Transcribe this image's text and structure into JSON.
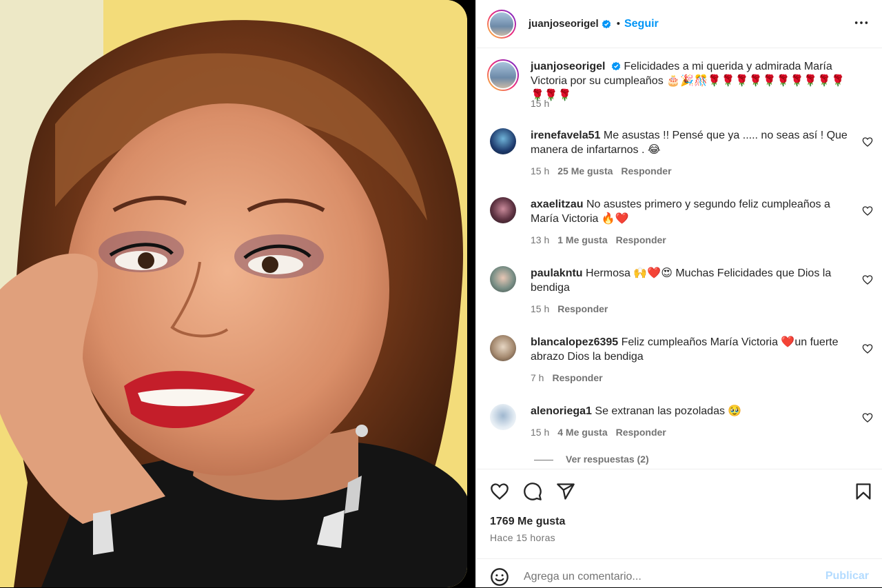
{
  "post": {
    "author": "juanjoseorigel",
    "follow_label": "Seguir",
    "separator": "•",
    "caption": "Felicidades a mi querida y admirada María Victoria por su cumpleaños 🎂🎉🎊🌹🌹🌹🌹🌹🌹🌹🌹🌹🌹🌹🌹🌹",
    "caption_time": "15 h"
  },
  "comments": [
    {
      "user": "irenefavela51",
      "text": "Me asustas !! Pensé que ya ..... no seas así ! Que manera de infartarnos . 😂",
      "time": "15 h",
      "likes": "25 Me gusta",
      "reply": "Responder"
    },
    {
      "user": "axaelitzau",
      "text": "No asustes primero y segundo feliz cumpleaños a María Victoria 🔥❤️",
      "time": "13 h",
      "likes": "1 Me gusta",
      "reply": "Responder"
    },
    {
      "user": "paulakntu",
      "text": "Hermosa 🙌❤️😍 Muchas Felicidades que Dios la bendiga",
      "time": "15 h",
      "likes": "",
      "reply": "Responder"
    },
    {
      "user": "blancalopez6395",
      "text": "Feliz cumpleaños María Victoria ❤️un fuerte abrazo Dios la bendiga",
      "time": "7 h",
      "likes": "",
      "reply": "Responder"
    },
    {
      "user": "alenoriega1",
      "text": "Se extranan las pozoladas 🥹",
      "time": "15 h",
      "likes": "4 Me gusta",
      "reply": "Responder"
    }
  ],
  "view_replies": "Ver respuestas (2)",
  "likes_total": "1769 Me gusta",
  "posted_ago": "Hace 15 horas",
  "add_comment": {
    "placeholder": "Agrega un comentario...",
    "publish_label": "Publicar"
  },
  "colors": {
    "accent": "#0095f6",
    "publish_disabled": "#b3dbff",
    "muted": "#737373"
  },
  "icons": [
    "verified-badge-icon",
    "more-options-icon",
    "heart-icon",
    "comment-icon",
    "share-icon",
    "bookmark-icon",
    "emoji-icon"
  ]
}
